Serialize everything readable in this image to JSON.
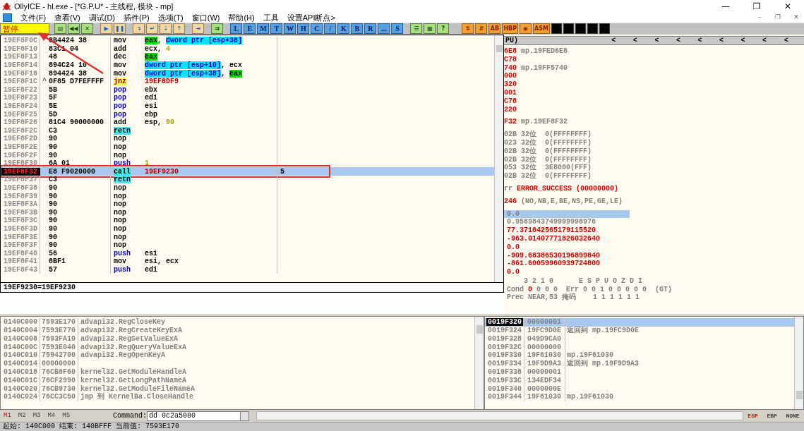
{
  "window": {
    "title": "OllyICE - hl.exe - [*G.P.U* - 主线程, 模块 - mp]",
    "controls": [
      "—",
      "❐",
      "✕"
    ]
  },
  "menu": {
    "items": [
      "文件(F)",
      "查看(V)",
      "调试(D)",
      "插件(P)",
      "选项(T)",
      "窗口(W)",
      "帮助(H)",
      "工具",
      "设置API断点>"
    ],
    "child_controls": [
      "–",
      "❐",
      "✕"
    ]
  },
  "toolbar": {
    "status": "暂停",
    "items": [
      {
        "kind": "icon",
        "text": "▤"
      },
      {
        "kind": "icon",
        "text": "◀◀"
      },
      {
        "kind": "icon",
        "text": "✕"
      },
      {
        "kind": "sep"
      },
      {
        "kind": "blue",
        "text": "▶"
      },
      {
        "kind": "blue",
        "text": "❚❚"
      },
      {
        "kind": "sep"
      },
      {
        "kind": "blue",
        "text": "↴"
      },
      {
        "kind": "blue",
        "text": "↵"
      },
      {
        "kind": "blue",
        "text": "⇣"
      },
      {
        "kind": "blue",
        "text": "⇡"
      },
      {
        "kind": "sep"
      },
      {
        "kind": "blue",
        "text": "⇥"
      },
      {
        "kind": "sep"
      },
      {
        "kind": "icon",
        "text": "⇉"
      },
      {
        "kind": "sep"
      },
      {
        "kind": "letter",
        "text": "L"
      },
      {
        "kind": "letter",
        "text": "E"
      },
      {
        "kind": "letter",
        "text": "M"
      },
      {
        "kind": "letter",
        "text": "T"
      },
      {
        "kind": "letter",
        "text": "W"
      },
      {
        "kind": "letter",
        "text": "H"
      },
      {
        "kind": "letter",
        "text": "C"
      },
      {
        "kind": "letter",
        "text": "/"
      },
      {
        "kind": "letter",
        "text": "K"
      },
      {
        "kind": "letter",
        "text": "B"
      },
      {
        "kind": "letter",
        "text": "R"
      },
      {
        "kind": "letter",
        "text": "..."
      },
      {
        "kind": "letter",
        "text": "S"
      },
      {
        "kind": "sep"
      },
      {
        "kind": "icon",
        "text": "☰"
      },
      {
        "kind": "icon",
        "text": "▦"
      },
      {
        "kind": "icon",
        "text": "?"
      },
      {
        "kind": "sep"
      },
      {
        "kind": "sep"
      },
      {
        "kind": "tool",
        "text": "⇅"
      },
      {
        "kind": "tool",
        "text": "⇵"
      },
      {
        "kind": "tool",
        "text": "AB"
      },
      {
        "kind": "tool",
        "text": "HBP"
      },
      {
        "kind": "tool",
        "text": "◉"
      },
      {
        "kind": "tool",
        "text": "ASM"
      },
      {
        "kind": "black"
      },
      {
        "kind": "black"
      },
      {
        "kind": "black"
      },
      {
        "kind": "black"
      },
      {
        "kind": "black"
      }
    ]
  },
  "disassembly": {
    "rows": [
      {
        "address": "19EF8F0C",
        "hex": "8B4424 38",
        "mnemonic": "mov",
        "kind": "plain",
        "selected": false,
        "operand": [
          {
            "text": "eax",
            "kind": "reg"
          },
          {
            "text": ", ",
            "kind": "plain"
          },
          {
            "text": "dword ptr [esp+38]",
            "kind": "mem"
          }
        ]
      },
      {
        "address": "19EF8F10",
        "hex": "83C1 04",
        "mnemonic": "add",
        "kind": "plain",
        "selected": false,
        "operand": [
          {
            "text": "ecx, ",
            "kind": "plain"
          },
          {
            "text": "4",
            "kind": "num"
          }
        ]
      },
      {
        "address": "19EF8F13",
        "hex": "48",
        "mnemonic": "dec",
        "kind": "plain",
        "selected": false,
        "operand": [
          {
            "text": "eax",
            "kind": "reg"
          }
        ]
      },
      {
        "address": "19EF8F14",
        "hex": "894C24 10",
        "mnemonic": "mov",
        "kind": "plain",
        "selected": false,
        "operand": [
          {
            "text": "dword ptr [esp+10]",
            "kind": "mem"
          },
          {
            "text": ", ecx",
            "kind": "plain"
          }
        ]
      },
      {
        "address": "19EF8F18",
        "hex": "894424 38",
        "mnemonic": "mov",
        "kind": "plain",
        "selected": false,
        "operand": [
          {
            "text": "dword ptr [esp+38]",
            "kind": "mem"
          },
          {
            "text": ", ",
            "kind": "plain"
          },
          {
            "text": "eax",
            "kind": "reg"
          }
        ]
      },
      {
        "address": "19EF8F1C",
        "jump_mark": "^",
        "hex": "0F85 D7FEFFFF",
        "mnemonic": "jnz",
        "kind": "jump",
        "selected": false,
        "operand": [
          {
            "text": "19EF8DF9",
            "kind": "addr"
          }
        ]
      },
      {
        "address": "19EF8F22",
        "hex": "5B",
        "mnemonic": "pop",
        "kind": "stack",
        "selected": false,
        "operand": [
          {
            "text": "ebx",
            "kind": "plain"
          }
        ]
      },
      {
        "address": "19EF8F23",
        "hex": "5F",
        "mnemonic": "pop",
        "kind": "stack",
        "selected": false,
        "operand": [
          {
            "text": "edi",
            "kind": "plain"
          }
        ]
      },
      {
        "address": "19EF8F24",
        "hex": "5E",
        "mnemonic": "pop",
        "kind": "stack",
        "selected": false,
        "operand": [
          {
            "text": "esi",
            "kind": "plain"
          }
        ]
      },
      {
        "address": "19EF8F25",
        "hex": "5D",
        "mnemonic": "pop",
        "kind": "stack",
        "selected": false,
        "operand": [
          {
            "text": "ebp",
            "kind": "plain"
          }
        ]
      },
      {
        "address": "19EF8F26",
        "hex": "81C4 90000000",
        "mnemonic": "add",
        "kind": "plain",
        "selected": false,
        "operand": [
          {
            "text": "esp, ",
            "kind": "plain"
          },
          {
            "text": "90",
            "kind": "num"
          }
        ]
      },
      {
        "address": "19EF8F2C",
        "hex": "C3",
        "mnemonic": "retn",
        "kind": "call",
        "selected": false
      },
      {
        "address": "19EF8F2D",
        "hex": "90",
        "mnemonic": "nop",
        "kind": "plain",
        "selected": false
      },
      {
        "address": "19EF8F2E",
        "hex": "90",
        "mnemonic": "nop",
        "kind": "plain",
        "selected": false
      },
      {
        "address": "19EF8F2F",
        "hex": "90",
        "mnemonic": "nop",
        "kind": "plain",
        "selected": false
      },
      {
        "address": "19EF8F30",
        "hex": "6A 01",
        "mnemonic": "push",
        "kind": "stack",
        "selected": false,
        "operand": [
          {
            "text": "1",
            "kind": "num"
          }
        ]
      },
      {
        "address": "19EF8F32",
        "hex": "E8 F9020000",
        "mnemonic": "call",
        "kind": "call",
        "selected": true,
        "operand": [
          {
            "text": "19EF9230",
            "kind": "addr"
          }
        ],
        "comment": "5"
      },
      {
        "address": "19EF8F37",
        "hex": "C3",
        "mnemonic": "retn",
        "kind": "call",
        "selected": false
      },
      {
        "address": "19EF8F38",
        "hex": "90",
        "mnemonic": "nop",
        "kind": "plain",
        "selected": false
      },
      {
        "address": "19EF8F39",
        "hex": "90",
        "mnemonic": "nop",
        "kind": "plain",
        "selected": false
      },
      {
        "address": "19EF8F3A",
        "hex": "90",
        "mnemonic": "nop",
        "kind": "plain",
        "selected": false
      },
      {
        "address": "19EF8F3B",
        "hex": "90",
        "mnemonic": "nop",
        "kind": "plain",
        "selected": false
      },
      {
        "address": "19EF8F3C",
        "hex": "90",
        "mnemonic": "nop",
        "kind": "plain",
        "selected": false
      },
      {
        "address": "19EF8F3D",
        "hex": "90",
        "mnemonic": "nop",
        "kind": "plain",
        "selected": false
      },
      {
        "address": "19EF8F3E",
        "hex": "90",
        "mnemonic": "nop",
        "kind": "plain",
        "selected": false
      },
      {
        "address": "19EF8F3F",
        "hex": "90",
        "mnemonic": "nop",
        "kind": "plain",
        "selected": false
      },
      {
        "address": "19EF8F40",
        "hex": "56",
        "mnemonic": "push",
        "kind": "stack",
        "selected": false,
        "operand": [
          {
            "text": "esi",
            "kind": "plain"
          }
        ]
      },
      {
        "address": "19EF8F41",
        "hex": "8BF1",
        "mnemonic": "mov",
        "kind": "plain",
        "selected": false,
        "operand": [
          {
            "text": "esi, ecx",
            "kind": "plain"
          }
        ]
      },
      {
        "address": "19EF8F43",
        "hex": "57",
        "mnemonic": "push",
        "kind": "stack",
        "selected": false,
        "operand": [
          {
            "text": "edi",
            "kind": "plain"
          }
        ]
      }
    ],
    "info": "19EF9230=19EF9230"
  },
  "registers": {
    "header": "PU)",
    "header_buttons": [
      "<",
      "<",
      "<",
      "<",
      "<",
      "<",
      "<",
      "<",
      "<"
    ],
    "groups": [
      [
        {
          "parts": [
            {
              "text": "6E8",
              "changed": true
            },
            {
              "text": " mp.19FED6E8",
              "changed": false
            }
          ]
        },
        {
          "parts": [
            {
              "text": "C78",
              "changed": true
            }
          ]
        },
        {
          "parts": [
            {
              "text": "740",
              "changed": true
            },
            {
              "text": " mp.19FF5740",
              "changed": false
            }
          ]
        },
        {
          "parts": [
            {
              "text": "000",
              "changed": true
            }
          ]
        },
        {
          "parts": [
            {
              "text": "320",
              "changed": true
            }
          ]
        },
        {
          "parts": [
            {
              "text": "001",
              "changed": true
            }
          ]
        },
        {
          "parts": [
            {
              "text": "C78",
              "changed": true
            }
          ]
        },
        {
          "parts": [
            {
              "text": "220",
              "changed": true
            }
          ]
        }
      ],
      [
        {
          "parts": [
            {
              "text": "F32",
              "changed": true
            },
            {
              "text": " mp.19EF8F32",
              "changed": false
            }
          ]
        }
      ],
      [
        {
          "parts": [
            {
              "text": "02B 32位  0(FFFFFFFF)",
              "changed": false
            }
          ]
        },
        {
          "parts": [
            {
              "text": "023 32位  0(FFFFFFFF)",
              "changed": false
            }
          ]
        },
        {
          "parts": [
            {
              "text": "02B 32位  0(FFFFFFFF)",
              "changed": false
            }
          ]
        },
        {
          "parts": [
            {
              "text": "02B 32位  0(FFFFFFFF)",
              "changed": false
            }
          ]
        },
        {
          "parts": [
            {
              "text": "053 32位  3E8000(FFF)",
              "changed": false
            }
          ]
        },
        {
          "parts": [
            {
              "text": "02B 32位  0(FFFFFFFF)",
              "changed": false
            }
          ]
        }
      ],
      [
        {
          "parts": [
            {
              "text": "rr ",
              "changed": false
            },
            {
              "text": "ERROR_SUCCESS (00000000)",
              "changed": true
            }
          ]
        }
      ],
      [
        {
          "parts": [
            {
              "text": "246",
              "changed": true
            },
            {
              "text": " (NO,NB,E,BE,NS,PE,GE,LE)",
              "changed": false
            }
          ]
        }
      ]
    ],
    "fpu": [
      {
        "text": "0.0",
        "changed": false,
        "selected": true
      },
      {
        "text": "0.9589843749999998976",
        "changed": false,
        "selected": false
      },
      {
        "text": "77.371842565179115520",
        "changed": true,
        "selected": false
      },
      {
        "text": "-963.01407771826032640",
        "changed": true,
        "selected": false
      },
      {
        "text": "0.0",
        "changed": true,
        "selected": false
      },
      {
        "text": "-909.68386530196899840",
        "changed": true,
        "selected": false
      },
      {
        "text": "-861.60059960939724800",
        "changed": true,
        "selected": false
      },
      {
        "text": "0.0",
        "changed": true,
        "selected": false
      }
    ],
    "status_lines": [
      [
        {
          "text": "    3 2 1 0      E S P U O Z D I",
          "changed": false
        }
      ],
      [
        {
          "text": "Cond ",
          "changed": false
        },
        {
          "text": "0",
          "changed": true
        },
        {
          "text": " 0 0 0  Err 0 0 1 0 0 0 0 0  (GT)",
          "changed": false
        }
      ],
      [
        {
          "text": "Prec NEAR,53 掩码    1 1 1 1 1 1",
          "changed": false
        }
      ]
    ]
  },
  "dump": {
    "rows": [
      {
        "address": "0140C000",
        "value": "7593E170",
        "comment": "advapi32.RegCloseKey"
      },
      {
        "address": "0140C004",
        "value": "7593E770",
        "comment": "advapi32.RegCreateKeyExA"
      },
      {
        "address": "0140C008",
        "value": "7593FA10",
        "comment": "advapi32.RegSetValueExA"
      },
      {
        "address": "0140C00C",
        "value": "7593E040",
        "comment": "advapi32.RegQueryValueExA"
      },
      {
        "address": "0140C010",
        "value": "75942700",
        "comment": "advapi32.RegOpenKeyA"
      },
      {
        "address": "0140C014",
        "value": "00000000"
      },
      {
        "address": "0140C018",
        "value": "76CB8F60",
        "comment": "kernel32.GetModuleHandleA"
      },
      {
        "address": "0140C01C",
        "value": "76CF2990",
        "comment": "kernel32.GetLongPathNameA"
      },
      {
        "address": "0140C020",
        "value": "76CB9730",
        "comment": "kernel32.GetModuleFileNameA"
      },
      {
        "address": "0140C024",
        "value": "76CC3C50",
        "comment": "jmp 到 KernelBa.CloseHandle"
      }
    ]
  },
  "stack": {
    "rows": [
      {
        "address": "0019F320",
        "value": "00000001",
        "selected": true
      },
      {
        "address": "0019F324",
        "value": "19FC9D0E",
        "comment": "返回到 mp.19FC9D0E",
        "selected": false
      },
      {
        "address": "0019F328",
        "value": "049D9CA0",
        "selected": false
      },
      {
        "address": "0019F32C",
        "value": "00000000",
        "selected": false
      },
      {
        "address": "0019F330",
        "value": "19F61030",
        "comment": "mp.19F61030",
        "selected": false
      },
      {
        "address": "0019F334",
        "value": "19F9D9A3",
        "comment": "返回到 mp.19F9D9A3",
        "selected": false
      },
      {
        "address": "0019F338",
        "value": "00000001",
        "selected": false
      },
      {
        "address": "0019F33C",
        "value": "134EDF34",
        "selected": false
      },
      {
        "address": "0019F340",
        "value": "0000000E",
        "selected": false
      },
      {
        "address": "0019F344",
        "value": "19F61030",
        "comment": "mp.19F61030",
        "selected": false
      }
    ]
  },
  "command_bar": {
    "tabs": [
      {
        "label": "M1",
        "selected": true
      },
      {
        "label": "M2",
        "selected": false
      },
      {
        "label": "M3",
        "selected": false
      },
      {
        "label": "M4",
        "selected": false
      },
      {
        "label": "M5",
        "selected": false
      }
    ],
    "label": "Command:",
    "value": "dd 0c2a5080",
    "stack_modes": [
      {
        "label": "ESP",
        "selected": true
      },
      {
        "label": "EBP",
        "selected": false
      },
      {
        "label": "NONE",
        "selected": false
      }
    ]
  },
  "status_bar": "起始: 140C000 结束: 140BFFF 当前值: 7593E170"
}
